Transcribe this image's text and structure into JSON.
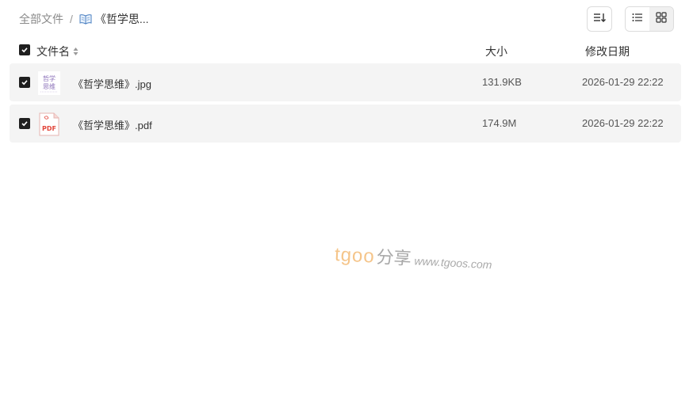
{
  "breadcrumb": {
    "root": "全部文件",
    "separator": "/",
    "current_icon": "open-book-icon",
    "current": "《哲学思..."
  },
  "toolbar": {
    "sort_icon": "sort-icon",
    "list_view_icon": "list-view-icon",
    "grid_view_icon": "grid-view-icon"
  },
  "table": {
    "columns": {
      "name": "文件名",
      "size": "大小",
      "date": "修改日期"
    },
    "rows": [
      {
        "name": "《哲学思维》.jpg",
        "size": "131.9KB",
        "date": "2026-01-29 22:22",
        "thumb_text": [
          "哲学",
          "思维"
        ],
        "checked": true
      },
      {
        "name": "《哲学思维》.pdf",
        "size": "174.9M",
        "date": "2026-01-29 22:22",
        "thumb_text": [
          "PDF"
        ],
        "checked": true
      }
    ]
  },
  "watermark": {
    "brand": "tgoo",
    "share": "分享",
    "url": "www.tgoos.com"
  },
  "colors": {
    "row_bg": "#f4f4f4",
    "checkbox": "#1f1f1f",
    "watermark_brand": "#f5c58a",
    "pdf_red": "#e2463b"
  }
}
